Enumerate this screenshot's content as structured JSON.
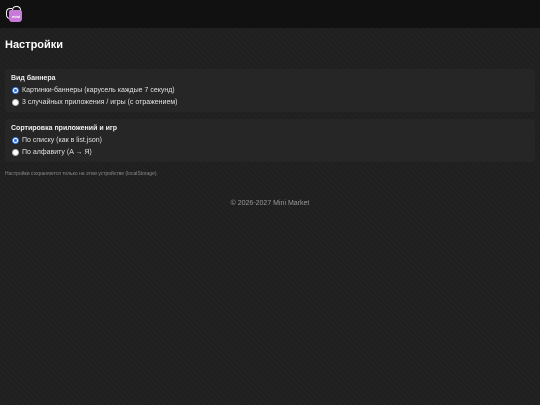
{
  "header": {
    "logo_icon": "shopping-bag-logo-icon",
    "logo_mark": "mini"
  },
  "page": {
    "title": "Настройки"
  },
  "banner_section": {
    "title": "Вид баннера",
    "options": [
      {
        "label": "Картинки-баннеры (карусель каждые 7 секунд)",
        "checked": true
      },
      {
        "label": "3 случайных приложения / игры (с отражением)",
        "checked": false
      }
    ]
  },
  "sort_section": {
    "title": "Сортировка приложений и игр",
    "options": [
      {
        "label": "По списку (как в list.json)",
        "checked": true
      },
      {
        "label": "По алфавиту (A → Я)",
        "checked": false
      }
    ]
  },
  "note": "Настройки сохраняются только на этом устройстве (localStorage).",
  "footer": {
    "copyright": "© 2026-2027 Mini Market"
  },
  "colors": {
    "background": "#1f1f1f",
    "topbar": "#111111",
    "card": "#262626",
    "accent_radio": "#2f6fe0",
    "logo": "#c77ad8"
  }
}
